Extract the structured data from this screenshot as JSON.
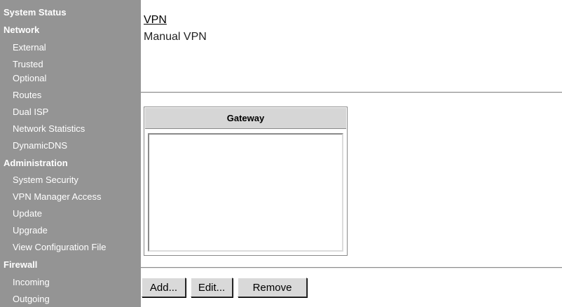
{
  "sidebar": {
    "sections": [
      {
        "label": "System Status"
      },
      {
        "label": "Network"
      },
      {
        "label": "Administration"
      },
      {
        "label": "Firewall"
      }
    ],
    "network_items": [
      "External",
      "Trusted",
      "Optional",
      "Routes",
      "Dual ISP",
      "Network Statistics",
      "DynamicDNS"
    ],
    "administration_items": [
      "System Security",
      "VPN Manager Access",
      "Update",
      "Upgrade",
      "View Configuration File"
    ],
    "firewall_items": [
      "Incoming",
      "Outgoing"
    ]
  },
  "main": {
    "breadcrumb": "VPN",
    "title": "Manual VPN",
    "table": {
      "header": "Gateway",
      "rows": []
    },
    "buttons": {
      "add": "Add...",
      "edit": "Edit...",
      "remove": "Remove"
    }
  },
  "colors": {
    "sidebar_bg": "#949494",
    "header_bg": "#d6d6d6",
    "button_bg": "#d9d9d9"
  }
}
